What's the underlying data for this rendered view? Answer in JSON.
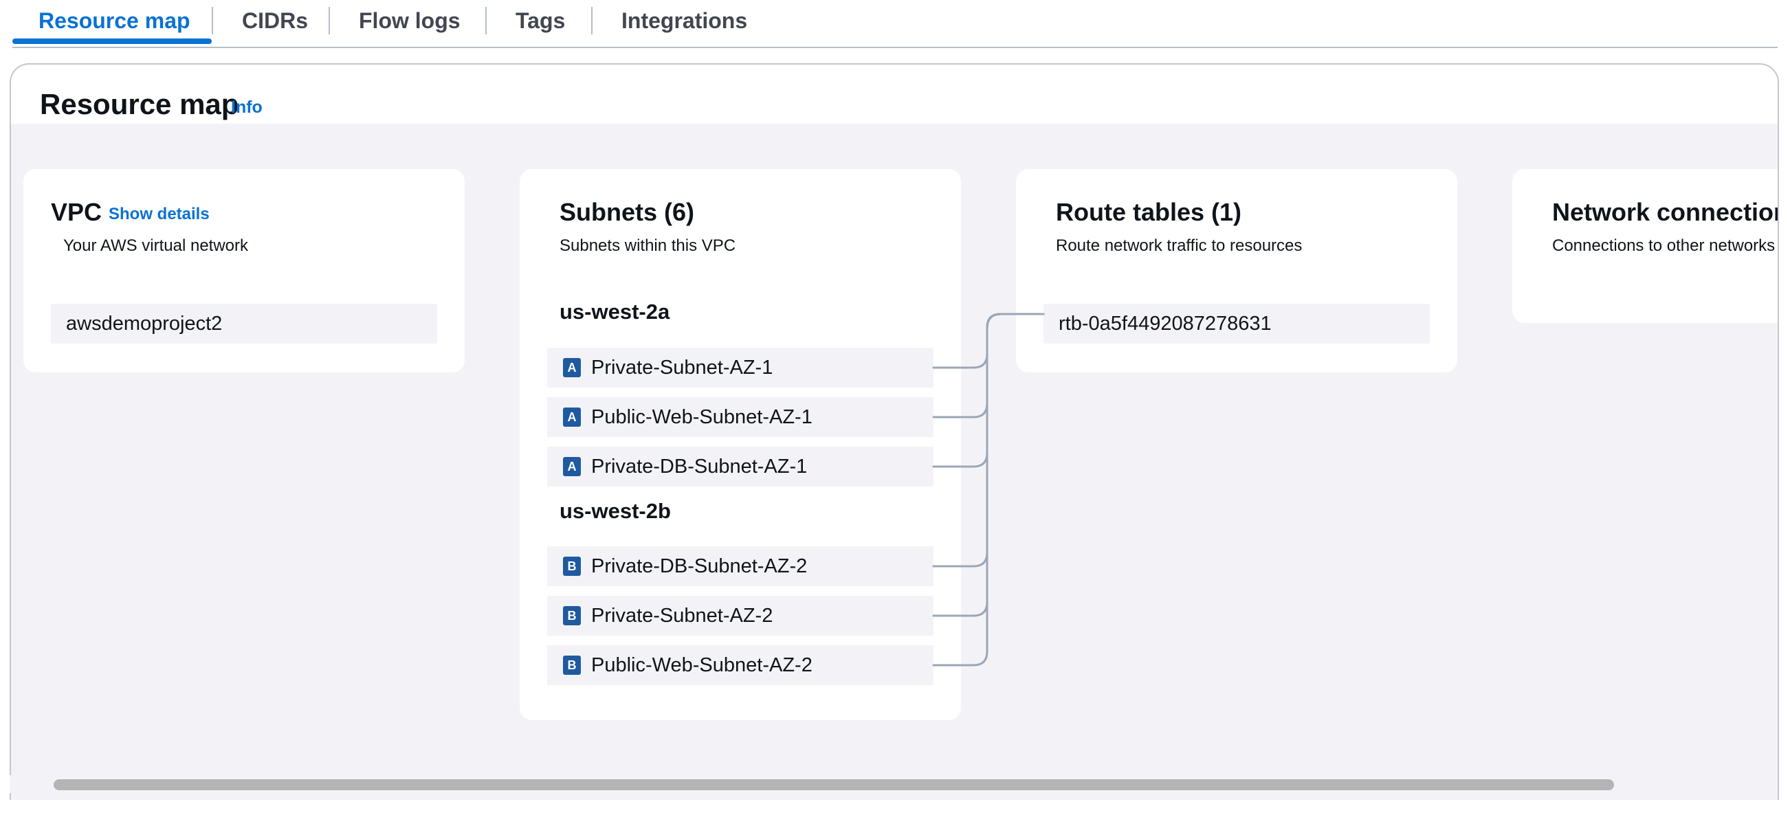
{
  "tabs": [
    {
      "label": "Resource map",
      "active": true
    },
    {
      "label": "CIDRs",
      "active": false
    },
    {
      "label": "Flow logs",
      "active": false
    },
    {
      "label": "Tags",
      "active": false
    },
    {
      "label": "Integrations",
      "active": false
    }
  ],
  "panel": {
    "title": "Resource map",
    "info_link": "Info"
  },
  "vpc_card": {
    "title": "VPC",
    "details_link": "Show details",
    "subtitle": "Your AWS virtual network",
    "vpc_name": "awsdemoproject2"
  },
  "subnets_card": {
    "title": "Subnets (6)",
    "subtitle": "Subnets within this VPC",
    "zones": [
      {
        "name": "us-west-2a",
        "badge": "A",
        "subnets": [
          "Private-Subnet-AZ-1",
          "Public-Web-Subnet-AZ-1",
          "Private-DB-Subnet-AZ-1"
        ]
      },
      {
        "name": "us-west-2b",
        "badge": "B",
        "subnets": [
          "Private-DB-Subnet-AZ-2",
          "Private-Subnet-AZ-2",
          "Public-Web-Subnet-AZ-2"
        ]
      }
    ]
  },
  "route_tables_card": {
    "title": "Route tables (1)",
    "subtitle": "Route network traffic to resources",
    "route_table_id": "rtb-0a5f4492087278631"
  },
  "network_connections_card": {
    "title": "Network connections",
    "subtitle": "Connections to other networks"
  },
  "colors": {
    "accent": "#0972d3",
    "az_badge": "#1f5aa0",
    "connector": "#9ba7b6",
    "canvas_bg": "#f3f3f7"
  }
}
